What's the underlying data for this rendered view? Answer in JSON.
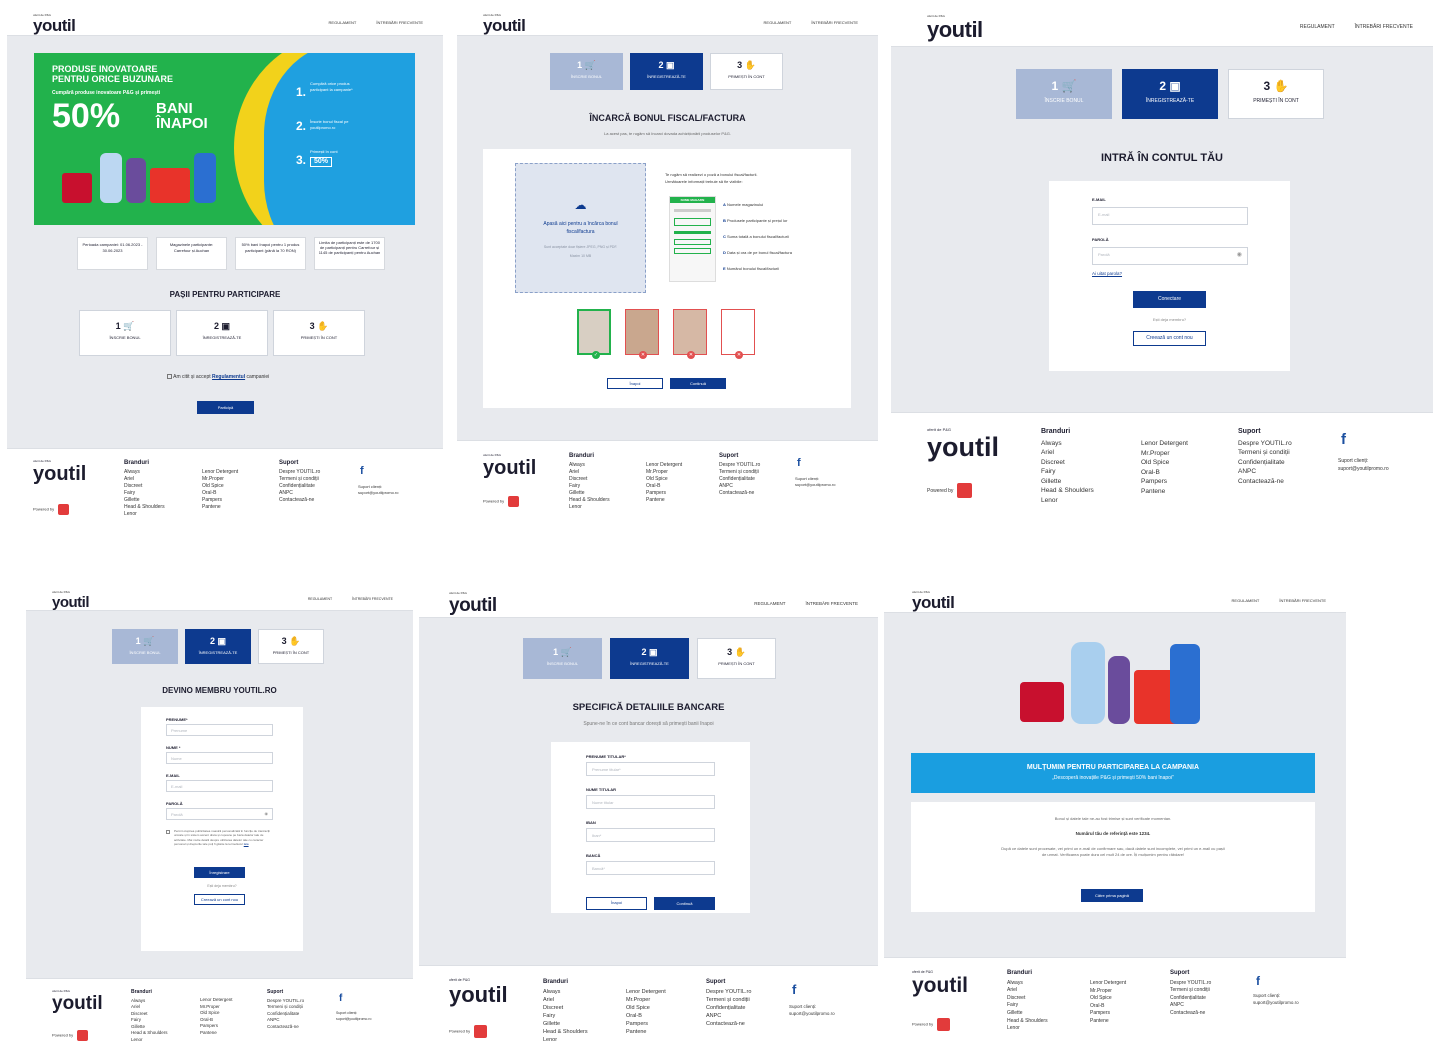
{
  "header": {
    "logo_sup": "oferit de P&G",
    "logo": "youtil",
    "nav_regulament": "REGULAMENT",
    "nav_faq": "ÎNTREBĂRI FRECVENTE"
  },
  "steps": {
    "s1_num": "1",
    "s1": "ÎNSCRIE BONUL",
    "s2_num": "2",
    "s2": "ÎNREGISTREAZĂ-TE",
    "s3_num": "3",
    "s3": "PRIMEȘTI ÎN CONT"
  },
  "footer": {
    "brands_title": "Branduri",
    "brands_col1": [
      "Always",
      "Ariel",
      "Discreet",
      "Fairy",
      "Gillette",
      "Head & Shoulders",
      "Lenor"
    ],
    "brands_col2": [
      "Lenor Detergent",
      "Mr.Proper",
      "Old Spice",
      "Oral-B",
      "Pampers",
      "Pantene"
    ],
    "support_title": "Suport",
    "support_items": [
      "Despre YOUTIL.ro",
      "Termeni și condiții",
      "Confidențialitate",
      "ANPC",
      "Contactează-ne"
    ],
    "powered": "Powered by",
    "fb": "f",
    "support_clients": "Suport clienți:",
    "support_email": "suport@youtilpromo.ro"
  },
  "panel1": {
    "hero_line1": "PRODUSE INOVATOARE",
    "hero_line2": "PENTRU ORICE BUZUNARE",
    "hero_sub": "Cumpără produse inovatoare P&G și primești",
    "hero_pct": "50%",
    "hero_bani": "BANI",
    "hero_inapoi": "ÎNAPOI",
    "hero_step1": "Cumpără orice produs participant la campanie*",
    "hero_step2": "Înscrie bonul fiscal pe youtilpromo.ro",
    "hero_step3": "Primești în cont",
    "hero_badge": "50%",
    "info1": "Perioada campaniei: 01.06.2023 - 30.06.2023",
    "info2": "Magazinele participante: Carrefour și Auchan",
    "info3": "50% bani înapoi pentru 1 produs participant (până la 70 RON)",
    "info4": "Limita de participanți este de 1700 de participanți pentru Carrefour și 1145 de participanți pentru Auchan",
    "steps_title": "PAȘII PENTRU PARTICIPARE",
    "agree_pre": "Am citit și accept",
    "agree_link": "Regulamentul",
    "agree_post": "campaniei",
    "cta": "Participă"
  },
  "panel2": {
    "title": "ÎNCARCĂ BONUL FISCAL/FACTURA",
    "sub": "La acest pas, te rugăm să încarci dovada achiziționării produselor P&G.",
    "drop_main": "Apasă aici pentru a încărca bonul fiscal/factura",
    "drop_formats": "Sunt acceptate doar fișiere JPEG, PNG și PDF.",
    "drop_size": "Maxim 10 MB",
    "instr1": "Te rugăm să realizezi o poză a bonului fiscal/facturii.",
    "instr2": "Următoarele informații trebuie să fie vizibile:",
    "receipt_header": "NUME MAGAZIN",
    "items": [
      {
        "k": "A",
        "t": "Numele magazinului"
      },
      {
        "k": "B",
        "t": "Produsele participante și prețul lor"
      },
      {
        "k": "C",
        "t": "Suma totală a bonului fiscal/facturii"
      },
      {
        "k": "D",
        "t": "Data și ora de pe bonul fiscal/factura"
      },
      {
        "k": "E",
        "t": "Numărul bonului fiscal/facturii"
      }
    ],
    "check_ok": "✓",
    "check_bad": "✕",
    "back": "Înapoi",
    "next": "Continuă"
  },
  "panel3": {
    "title": "INTRĂ ÎN CONTUL TĂU",
    "email_label": "E-MAIL",
    "email_ph": "E-mail",
    "pass_label": "PAROLĂ",
    "pass_ph": "Parolă",
    "forgot": "Ai uitat parola?",
    "login": "Conectare",
    "already": "Ești deja membru?",
    "create": "Creează un cont nou"
  },
  "panel4": {
    "title": "DEVINO MEMBRU YOUTIL.RO",
    "fn_label": "PRENUME*",
    "fn_ph": "Prenume",
    "ln_label": "NUME *",
    "ln_ph": "Nume",
    "email_label": "E-MAIL",
    "email_ph": "E-mail",
    "pass_label": "PAROLĂ",
    "pass_ph": "Parolă",
    "consent": "Permit otopirea publicitatea noastră personalizată în funcție de tranzacții unicale și în sistem accent dreta și cupoane pe baza datelor tale de activitate. Mai multe detalii despre utilizarea datelor tale cu caracter personal și drepturile tale poți fi găsite la termeliucul",
    "consent_link": "lata",
    "register": "Înregistrare",
    "already": "Ești deja membru?",
    "create": "Creează un cont nou"
  },
  "panel5": {
    "title": "SPECIFICĂ DETALIILE BANCARE",
    "sub": "Spune-ne în ce cont bancar dorești să primești banii înapoi",
    "holder_fn_label": "PRENUME TITULAR*",
    "holder_fn_ph": "Prenume titular*",
    "holder_ln_label": "NUME TITULAR",
    "holder_ln_ph": "Nume titular",
    "iban_label": "IBAN",
    "iban_ph": "Iban*",
    "bank_label": "BANCĂ",
    "bank_ph": "Bancă*",
    "back": "Înapoi",
    "next": "Continuă"
  },
  "panel6": {
    "banner_title": "MULȚUMIM PENTRU PARTICIPAREA LA CAMPANIA",
    "banner_sub": "„Descoperă inovațiile P&G și primești 50% bani înapoi”",
    "msg1": "Bonul și datele tale ne-au fost trimise și sunt verificate momentan.",
    "msg2": "Numărul tău de referință este 1234.",
    "msg3": "După ce datele sunt procesate, vei primi un e-mail de confirmare sau, dacă datele sunt incomplete, vei primi un e-mail cu pașii de urmat. Verificarea poate dura cel mult 24 de ore. Îți mulțumim pentru răbdare!",
    "home": "Către prima pagină"
  },
  "colors": {
    "navy": "#0d3a8f",
    "hero_green": "#22b24c",
    "hero_blue": "#1fa0e0",
    "banner": "#1a9ee0"
  }
}
